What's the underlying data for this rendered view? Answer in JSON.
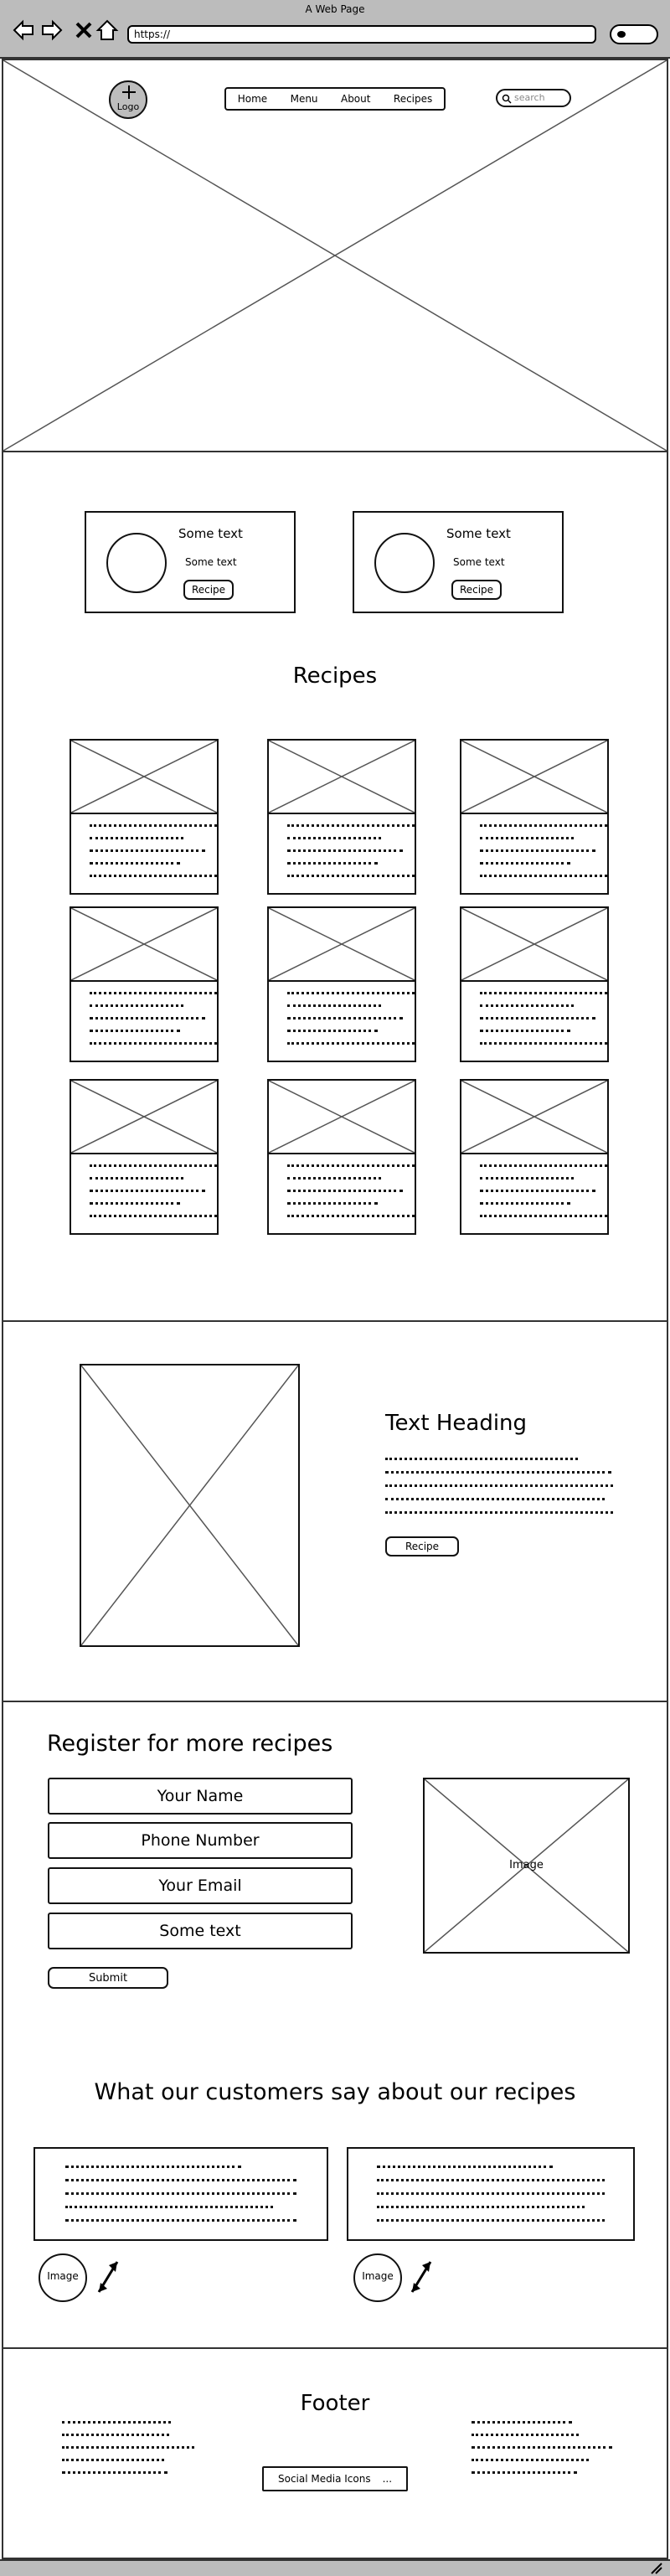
{
  "window": {
    "title": "A Web Page"
  },
  "address_bar": {
    "url": "https://"
  },
  "header": {
    "logo_label": "Logo",
    "nav": [
      "Home",
      "Menu",
      "About",
      "Recipes"
    ],
    "search_placeholder": "search"
  },
  "feature_cards": [
    {
      "title": "Some text",
      "subtitle": "Some text",
      "button": "Recipe"
    },
    {
      "title": "Some text",
      "subtitle": "Some text",
      "button": "Recipe"
    }
  ],
  "recipes": {
    "heading": "Recipes"
  },
  "feature_text": {
    "heading": "Text Heading",
    "button": "Recipe"
  },
  "register": {
    "heading": "Register for more recipes",
    "fields": [
      "Your Name",
      "Phone Number",
      "Your Email",
      "Some text"
    ],
    "submit": "Submit",
    "image_label": "Image"
  },
  "testimonials": {
    "heading": "What our customers say about our recipes",
    "avatar_label": "Image"
  },
  "footer": {
    "heading": "Footer",
    "social_button": "Social Media Icons",
    "social_ellipsis": "..."
  }
}
